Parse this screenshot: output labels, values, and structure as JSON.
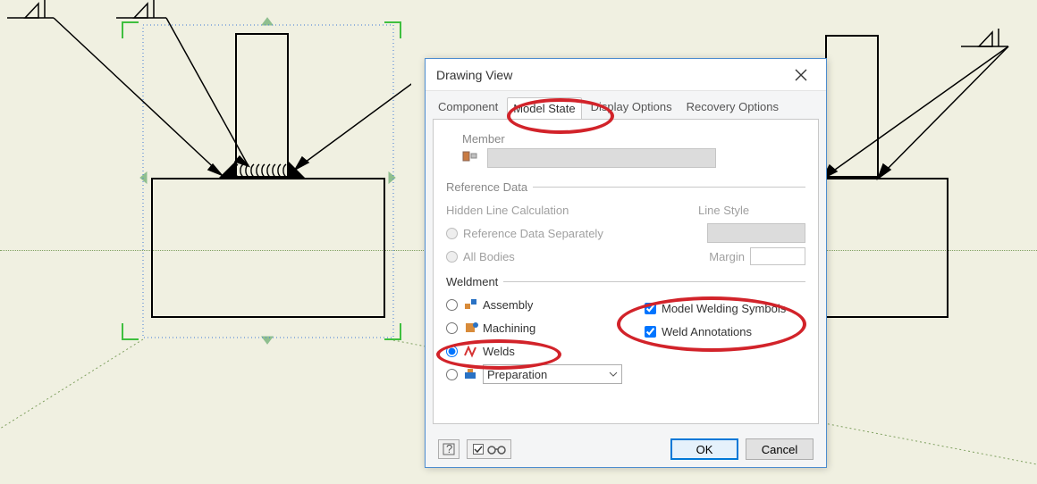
{
  "dialog": {
    "title": "Drawing View",
    "tabs": {
      "component": "Component",
      "model_state": "Model State",
      "display_options": "Display Options",
      "recovery_options": "Recovery Options"
    }
  },
  "member_section": {
    "label": "Member"
  },
  "refdata": {
    "group": "Reference Data",
    "hidden_line": "Hidden Line Calculation",
    "line_style": "Line Style",
    "sep": "Reference Data Separately",
    "all_bodies": "All Bodies",
    "margin": "Margin"
  },
  "weldment": {
    "group": "Weldment",
    "assembly": "Assembly",
    "machining": "Machining",
    "welds": "Welds",
    "preparation": "Preparation",
    "model_symbols": "Model Welding Symbols",
    "weld_annotations": "Weld Annotations"
  },
  "buttons": {
    "ok": "OK",
    "cancel": "Cancel"
  }
}
